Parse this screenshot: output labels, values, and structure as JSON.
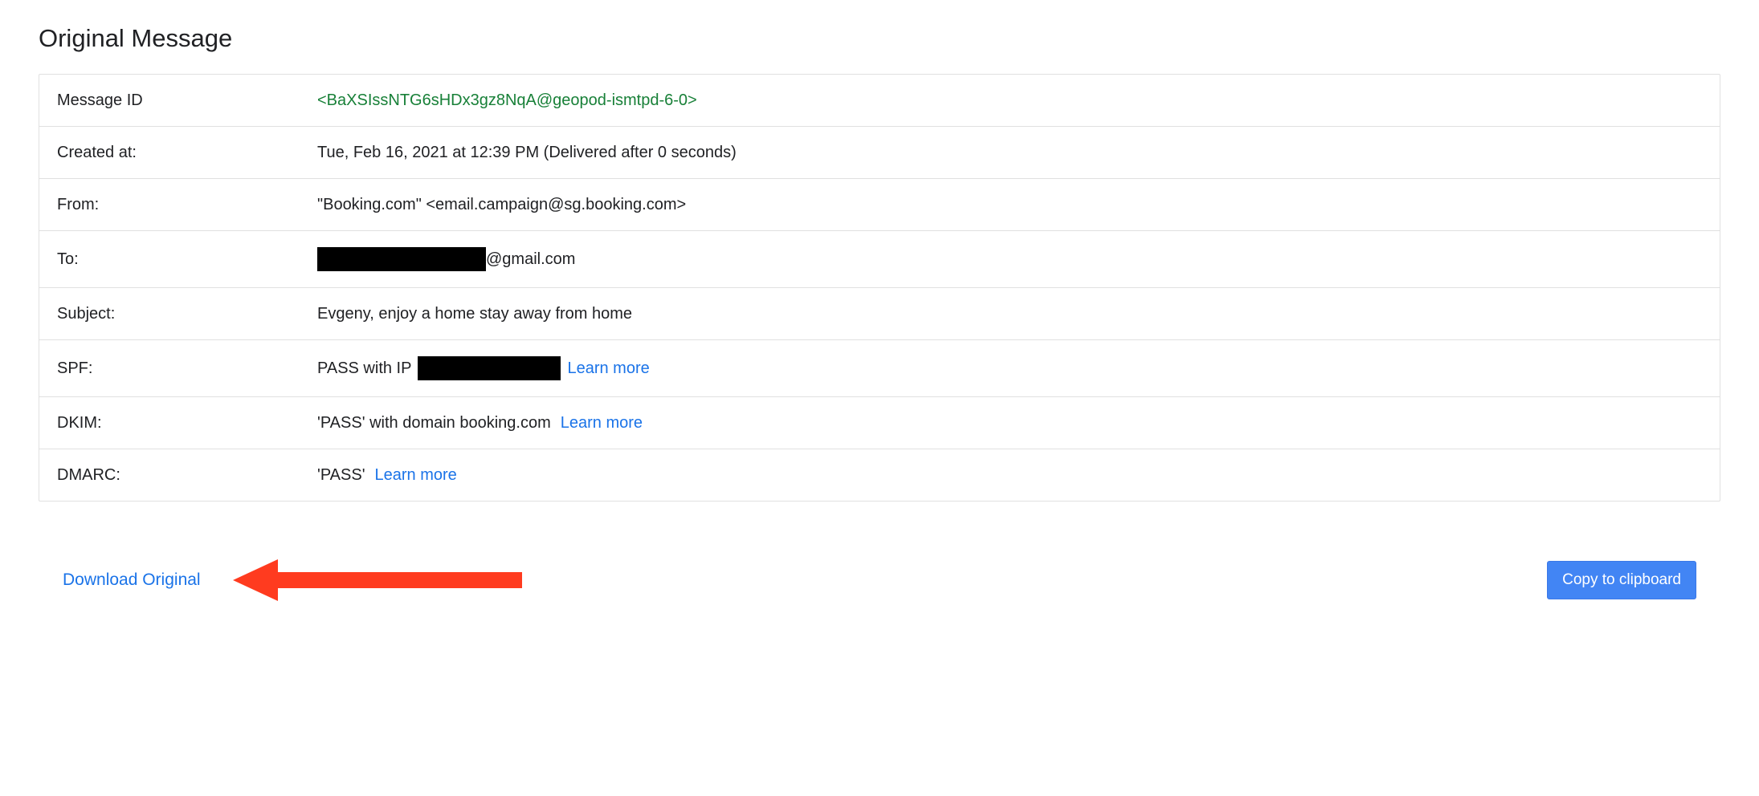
{
  "heading": "Original Message",
  "rows": {
    "message_id": {
      "label": "Message ID",
      "value": "<BaXSIssNTG6sHDx3gz8NqA@geopod-ismtpd-6-0>"
    },
    "created_at": {
      "label": "Created at:",
      "value": "Tue, Feb 16, 2021 at 12:39 PM (Delivered after 0 seconds)"
    },
    "from": {
      "label": "From:",
      "value": "\"Booking.com\" <email.campaign@sg.booking.com>"
    },
    "to": {
      "label": "To:",
      "suffix": "@gmail.com"
    },
    "subject": {
      "label": "Subject:",
      "value": "Evgeny, enjoy a home stay away from home"
    },
    "spf": {
      "label": "SPF:",
      "prefix": "PASS with IP",
      "learn_more": "Learn more"
    },
    "dkim": {
      "label": "DKIM:",
      "value": "'PASS' with domain booking.com",
      "learn_more": "Learn more"
    },
    "dmarc": {
      "label": "DMARC:",
      "value": "'PASS'",
      "learn_more": "Learn more"
    }
  },
  "actions": {
    "download": "Download Original",
    "copy": "Copy to clipboard"
  }
}
